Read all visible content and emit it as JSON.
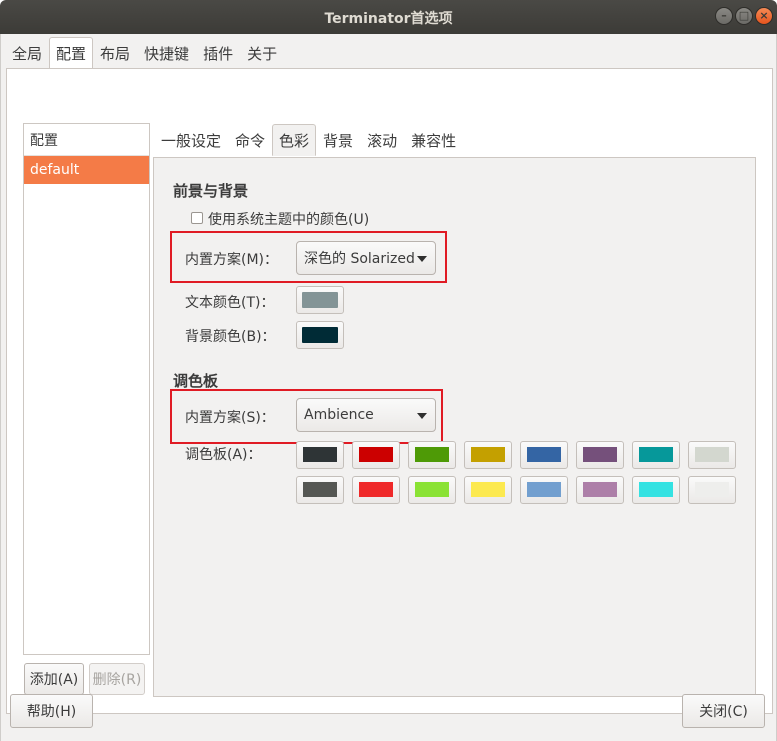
{
  "window": {
    "title": "Terminator首选项"
  },
  "top_tabs": [
    "全局",
    "配置",
    "布局",
    "快捷键",
    "插件",
    "关于"
  ],
  "profiles": {
    "header": "配置",
    "items": [
      "default"
    ],
    "add_button": "添加(A)",
    "delete_button": "删除(R)"
  },
  "profile_tabs": [
    "一般设定",
    "命令",
    "色彩",
    "背景",
    "滚动",
    "兼容性"
  ],
  "colors_tab": {
    "fg_bg_title": "前景与背景",
    "use_system_theme": "使用系统主题中的颜色(U)",
    "builtin_scheme_label": "内置方案(M)：",
    "builtin_scheme_value": "深色的 Solarized",
    "text_color_label": "文本颜色(T)：",
    "text_color": "#839496",
    "bg_color_label": "背景颜色(B)：",
    "bg_color": "#002b36",
    "palette_title": "调色板",
    "palette_scheme_label": "内置方案(S)：",
    "palette_scheme_value": "Ambience",
    "palette_label": "调色板(A)：",
    "palette_row1": [
      "#2e3436",
      "#cc0000",
      "#4e9a06",
      "#c4a000",
      "#3465a4",
      "#75507b",
      "#06989a",
      "#d3d7cf"
    ],
    "palette_row2": [
      "#555753",
      "#ef2929",
      "#8ae234",
      "#fce94f",
      "#729fcf",
      "#ad7fa8",
      "#34e2e2",
      "#eeeeec"
    ]
  },
  "footer": {
    "help_button": "帮助(H)",
    "close_button": "关闭(C)"
  },
  "accent_color": "#f47b47",
  "highlight_color": "#e01b24"
}
